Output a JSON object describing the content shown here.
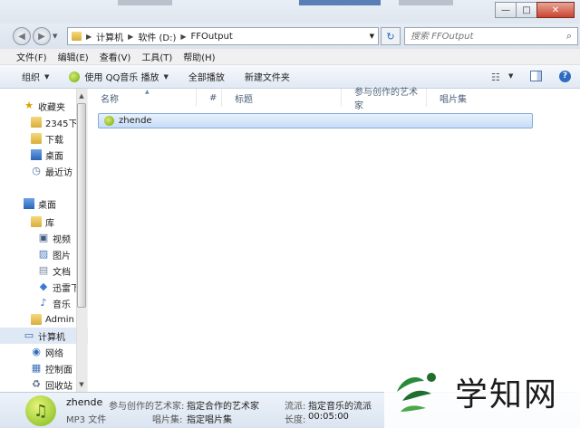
{
  "window": {
    "controls": {
      "minimize": "—",
      "maximize": "□",
      "close": "✕"
    }
  },
  "address": {
    "crumbs": [
      "计算机",
      "软件 (D:)",
      "FFOutput"
    ],
    "search_placeholder": "搜索 FFOutput"
  },
  "menu": [
    "文件(F)",
    "编辑(E)",
    "查看(V)",
    "工具(T)",
    "帮助(H)"
  ],
  "toolbar": {
    "organize": "组织",
    "play_with": "使用 QQ音乐 播放",
    "play_all": "全部播放",
    "new_folder": "新建文件夹"
  },
  "nav": [
    {
      "label": "收藏夹",
      "icon": "star-icon"
    },
    {
      "label": "2345下",
      "icon": "folder-icon"
    },
    {
      "label": "下载",
      "icon": "download-folder-icon"
    },
    {
      "label": "桌面",
      "icon": "desktop-icon"
    },
    {
      "label": "最近访",
      "icon": "recent-places-icon"
    },
    {
      "label": "桌面",
      "icon": "desktop-icon"
    },
    {
      "label": "库",
      "icon": "library-icon"
    },
    {
      "label": "视频",
      "icon": "video-icon"
    },
    {
      "label": "图片",
      "icon": "picture-icon"
    },
    {
      "label": "文档",
      "icon": "document-icon"
    },
    {
      "label": "迅雷下",
      "icon": "xunlei-icon"
    },
    {
      "label": "音乐",
      "icon": "music-icon"
    },
    {
      "label": "Admin",
      "icon": "user-folder-icon"
    },
    {
      "label": "计算机",
      "icon": "computer-icon"
    },
    {
      "label": "网络",
      "icon": "network-icon"
    },
    {
      "label": "控制面",
      "icon": "control-panel-icon"
    },
    {
      "label": "回收站",
      "icon": "recycle-bin-icon"
    }
  ],
  "columns": [
    "名称",
    "#",
    "标题",
    "参与创作的艺术家",
    "唱片集"
  ],
  "files": [
    {
      "name": "zhende"
    }
  ],
  "details": {
    "name": "zhende",
    "type": "MP3 文件",
    "artist_label": "参与创作的艺术家:",
    "artist_value": "指定合作的艺术家",
    "album_label": "唱片集:",
    "album_value": "指定唱片集",
    "genre_label": "流派:",
    "genre_value": "指定音乐的流派",
    "length_label": "长度:",
    "length_value": "00:05:00"
  },
  "watermark": {
    "text": "学知网"
  },
  "colors": {
    "selection": "#c7dcf6",
    "selection_border": "#84acdd",
    "close_button": "#c9452f"
  }
}
